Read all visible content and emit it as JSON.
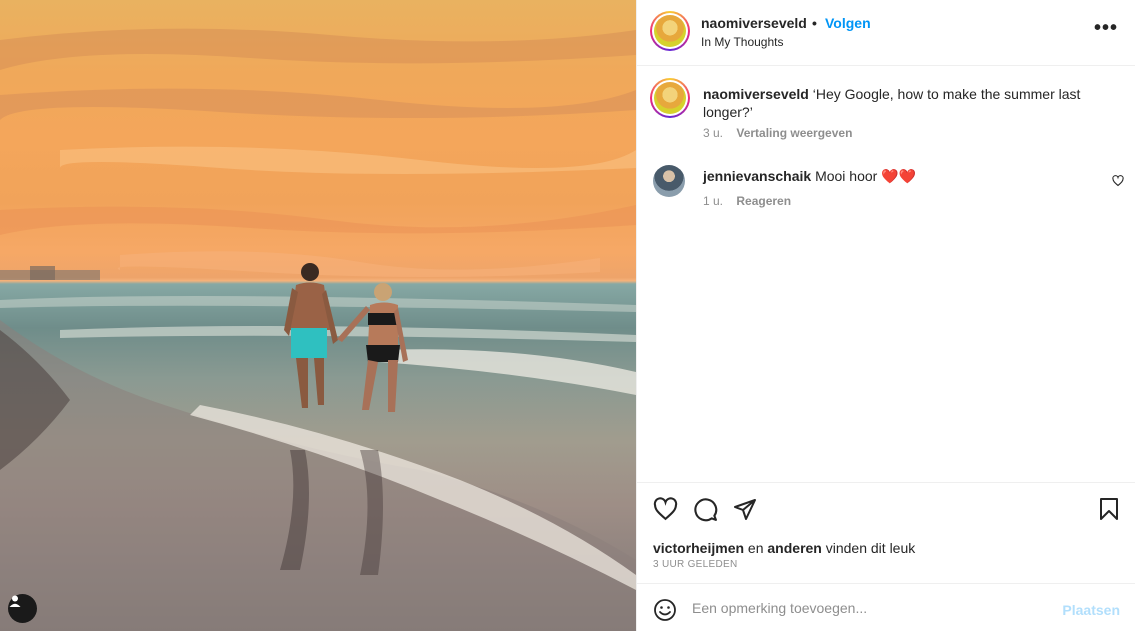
{
  "post": {
    "author": "naomiverseveld",
    "follow_label": "Volgen",
    "separator": "•",
    "location": "In My Thoughts",
    "more_label": "•••"
  },
  "caption": {
    "username": "naomiverseveld",
    "text": "‘Hey Google, how to make the summer last longer?’",
    "age": "3 u.",
    "translate_label": "Vertaling weergeven"
  },
  "comments": [
    {
      "username": "jennievanschaik",
      "text": "Mooi hoor ❤️❤️",
      "age": "1 u.",
      "reply_label": "Reageren"
    }
  ],
  "actions": {
    "liked_by": "victorheijmen",
    "and_text": "en",
    "others_label": "anderen",
    "suffix": "vinden dit leuk",
    "timestamp": "3 UUR GELEDEN"
  },
  "comment_box": {
    "placeholder": "Een opmerking toevoegen...",
    "post_label": "Plaatsen"
  },
  "colors": {
    "accent": "#0095f6",
    "post_disabled": "#b2dffc",
    "muted": "#8e8e8e",
    "text": "#262626"
  }
}
